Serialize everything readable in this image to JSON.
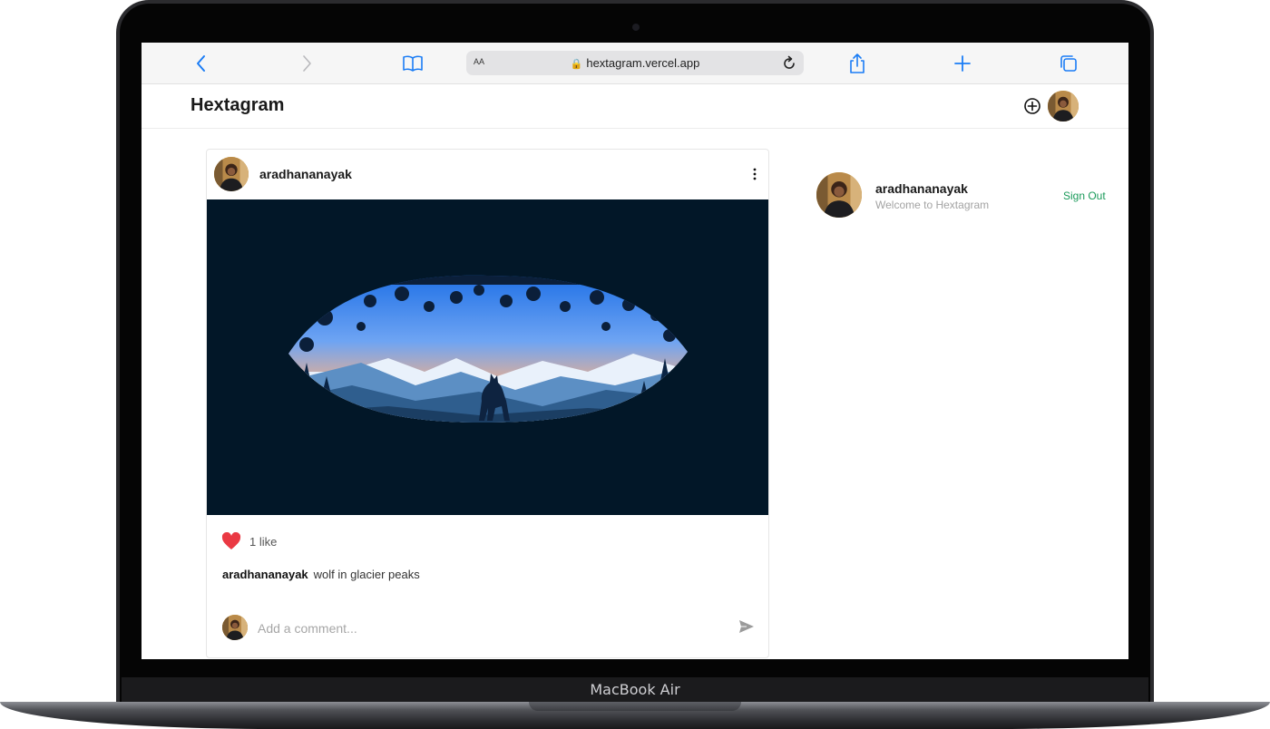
{
  "device": {
    "model_label": "MacBook Air"
  },
  "browser": {
    "text_size_label": "AA",
    "url": "hextagram.vercel.app",
    "icons": {
      "back": "chevron-left-icon",
      "forward": "chevron-right-icon",
      "bookmarks": "book-icon",
      "secure": "lock-icon",
      "reload": "reload-icon",
      "share": "share-icon",
      "new_tab": "plus-icon",
      "tabs": "tabs-icon"
    },
    "accent_color": "#1a7cf5"
  },
  "header": {
    "brand": "Hextagram",
    "add_post_icon": "circle-plus-icon",
    "avatar_icon": "profile-avatar"
  },
  "post": {
    "username": "aradhananayak",
    "menu_icon": "kebab-menu-icon",
    "image_icon": "wolf-landscape-illustration",
    "likes_label": "1 like",
    "like_icon": "heart-icon",
    "like_color": "#ea3943",
    "caption_user": "aradhananayak",
    "caption_text": "wolf in glacier peaks",
    "comment_placeholder": "Add a comment...",
    "send_icon": "send-icon"
  },
  "sidebar": {
    "username": "aradhananayak",
    "welcome": "Welcome to Hextagram",
    "sign_out_label": "Sign Out",
    "sign_out_color": "#1a9a5a"
  }
}
